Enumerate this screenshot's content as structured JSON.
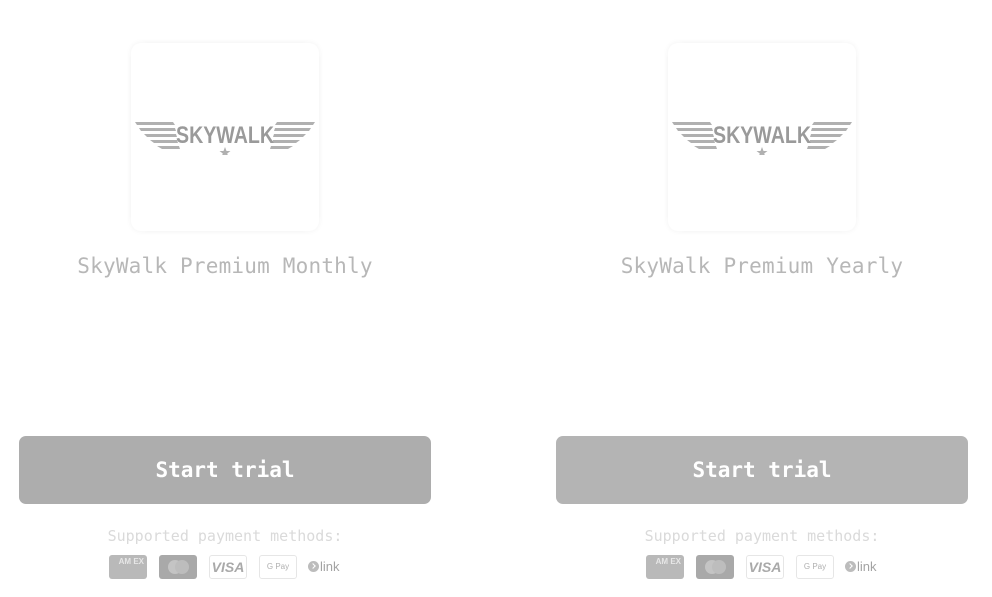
{
  "products": [
    {
      "logo_text": "SKYWALK",
      "name": "SkyWalk Premium Monthly",
      "button_label": "Start trial",
      "payment_label": "Supported payment methods:",
      "payment_methods": [
        "amex-icon",
        "mastercard-icon",
        "visa-icon",
        "google-pay-icon",
        "link-icon"
      ]
    },
    {
      "logo_text": "SKYWALK",
      "name": "SkyWalk Premium Yearly",
      "button_label": "Start trial",
      "payment_label": "Supported payment methods:",
      "payment_methods": [
        "amex-icon",
        "mastercard-icon",
        "visa-icon",
        "google-pay-icon",
        "link-icon"
      ]
    }
  ],
  "payment_icons": {
    "amex": "AM EX",
    "visa": "VISA",
    "gpay": "G Pay",
    "link": "link"
  },
  "colors": {
    "button": "#adadad",
    "title_text": "#b7b7b7",
    "label_text": "#dadada"
  }
}
